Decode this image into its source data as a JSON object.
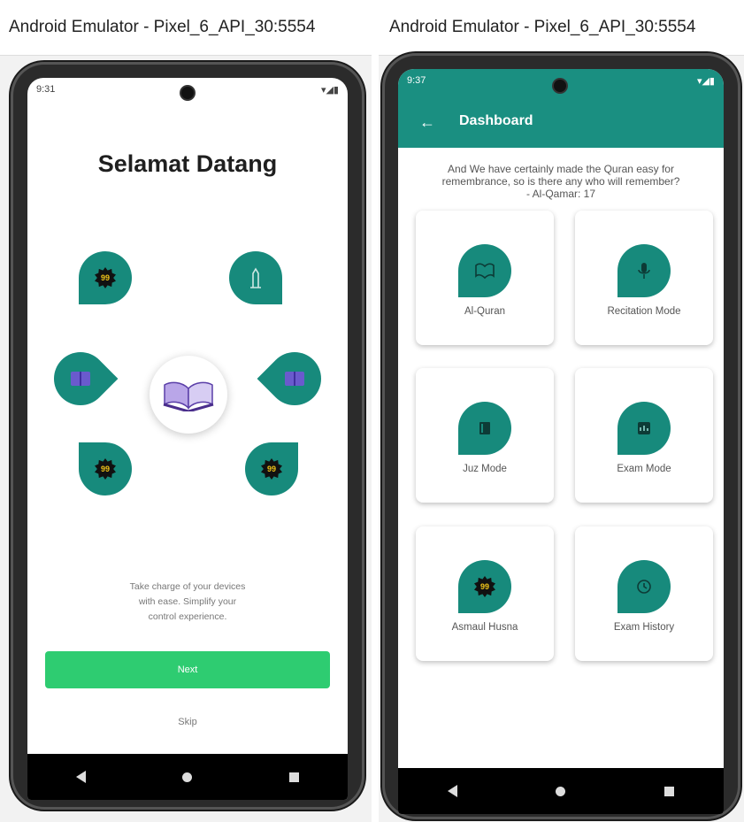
{
  "left_window": {
    "title": "Android Emulator - Pixel_6_API_30:5554",
    "status_time": "9:31",
    "welcome_title": "Selamat Datang",
    "description_line1": "Take charge of your devices",
    "description_line2": "with ease. Simplify your",
    "description_line3": "control experience.",
    "next_label": "Next",
    "skip_label": "Skip",
    "badge_text": "99"
  },
  "right_window": {
    "title": "Android Emulator - Pixel_6_API_30:5554",
    "status_time": "9:37",
    "appbar_title": "Dashboard",
    "back_glyph": "←",
    "quote_line1": "And We have certainly made the Quran easy for",
    "quote_line2": "remembrance, so is there any who will remember?",
    "quote_line3": "- Al-Qamar: 17",
    "cards": [
      {
        "label": "Al-Quran",
        "icon": "quran-icon"
      },
      {
        "label": "Recitation Mode",
        "icon": "microphone-icon"
      },
      {
        "label": "Juz Mode",
        "icon": "book-icon"
      },
      {
        "label": "Exam Mode",
        "icon": "exam-icon"
      },
      {
        "label": "Asmaul Husna",
        "icon": "badge-icon"
      },
      {
        "label": "Exam History",
        "icon": "history-icon"
      }
    ]
  },
  "colors": {
    "primary": "#1a8f81",
    "accent_green": "#2ecc71",
    "bubble": "#178a7c"
  }
}
